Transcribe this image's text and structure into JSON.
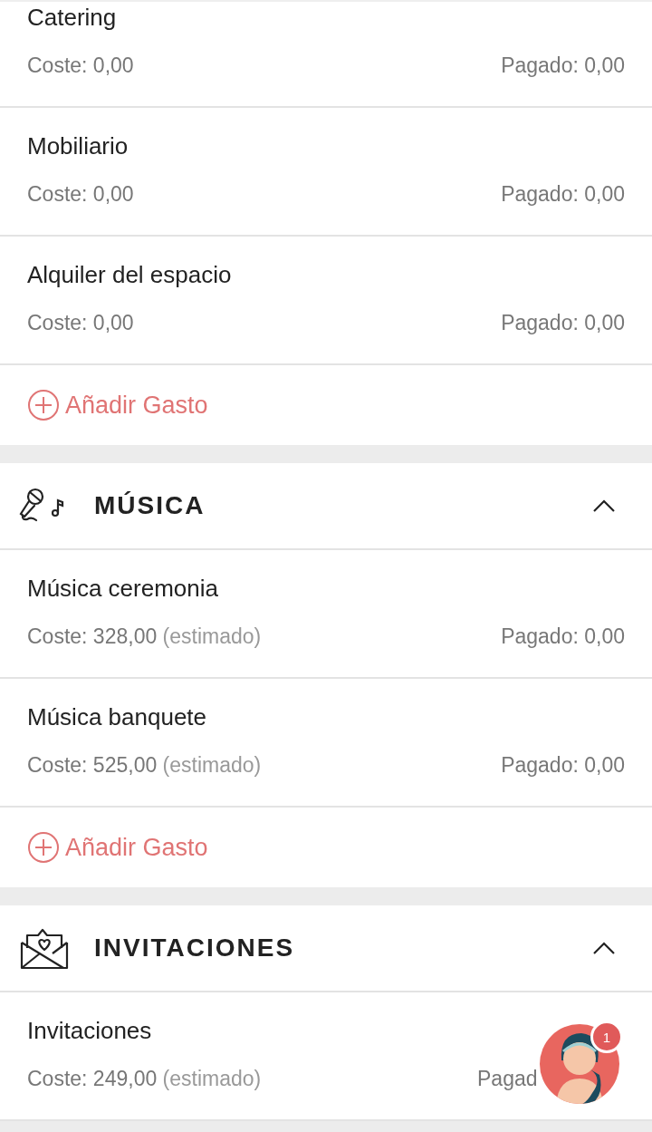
{
  "sections": [
    {
      "items": [
        {
          "name": "Catering",
          "cost": "Coste: 0,00",
          "paid": "Pagado: 0,00"
        },
        {
          "name": "Mobiliario",
          "cost": "Coste: 0,00",
          "paid": "Pagado: 0,00"
        },
        {
          "name": "Alquiler del espacio",
          "cost": "Coste: 0,00",
          "paid": "Pagado: 0,00"
        }
      ],
      "add_label": "Añadir Gasto"
    },
    {
      "title": "MÚSICA",
      "expanded": true,
      "items": [
        {
          "name": "Música ceremonia",
          "cost": "Coste: 328,00",
          "estimate": "(estimado)",
          "paid": "Pagado: 0,00"
        },
        {
          "name": "Música banquete",
          "cost": "Coste: 525,00",
          "estimate": "(estimado)",
          "paid": "Pagado: 0,00"
        }
      ],
      "add_label": "Añadir Gasto"
    },
    {
      "title": "INVITACIONES",
      "expanded": true,
      "items": [
        {
          "name": "Invitaciones",
          "cost": "Coste: 249,00",
          "estimate": "(estimado)",
          "paid": "Pagad"
        }
      ]
    }
  ],
  "assistant": {
    "badge": "1"
  }
}
